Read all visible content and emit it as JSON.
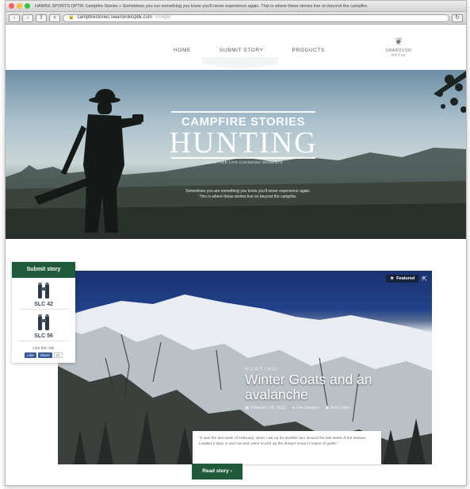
{
  "browser": {
    "window_title": "HAWKE SPORTS OPTIK Campfire Stories » Sometimes you run something you know you'll never experience again. This is where these stories live on beyond the campfire.",
    "url": "campfirestories.swarovskioptik.com",
    "url_hint": "Google"
  },
  "nav": {
    "links": [
      "HOME",
      "SUBMIT STORY",
      "PRODUCTS"
    ],
    "brand_name": "SWAROVSKI",
    "brand_sub": "OPTIK"
  },
  "hero": {
    "kicker": "CAMPFIRE STORIES",
    "title": "HUNTING",
    "strap": "AND OTHER LIFE-CHANGING MOMENTS",
    "tagline_1": "Sometimes you are something you know you'll never experience again.",
    "tagline_2": "This is where these stories live on beyond the campfire."
  },
  "sidebar": {
    "submit_label": "Submit story",
    "products": [
      {
        "name": "SLC 42"
      },
      {
        "name": "SLC 56"
      }
    ],
    "like_label": "Like this site",
    "fb_like": "Like",
    "fb_share": "Share",
    "fb_count": "12"
  },
  "story": {
    "featured_label": "Featured",
    "category": "HUNTING",
    "title": "Winter Goats and an avalanche",
    "date": "February 18, 2013",
    "author": "Jon Tamara",
    "comments": "Join Cabin",
    "excerpt": "\"It was the last week of February, when I set up for another turn around the last week of the season. Loaded 2 days in and out and came to pick up the deeper snow in hopes of goats.\"",
    "read_more": "Read story ›"
  }
}
